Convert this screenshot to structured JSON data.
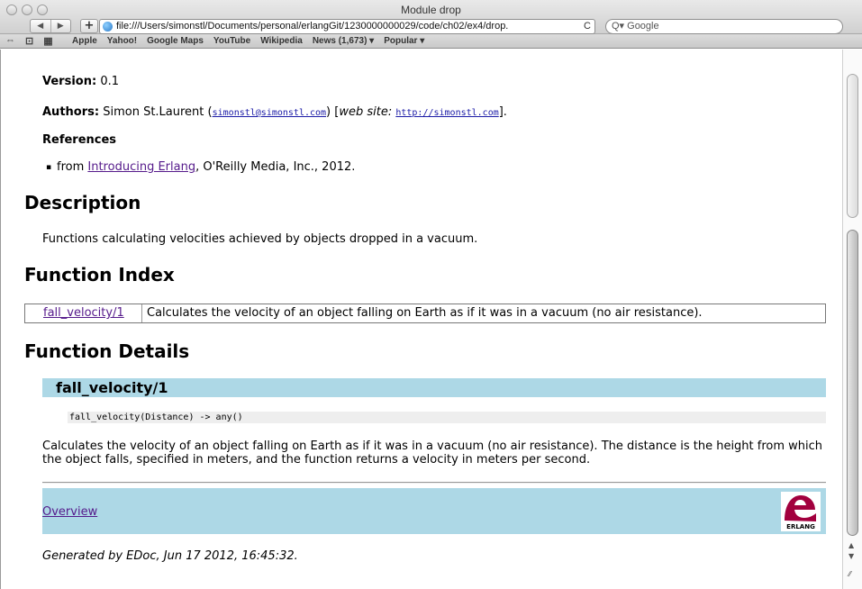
{
  "window": {
    "title": "Module drop"
  },
  "toolbar": {
    "back_label": "◀",
    "forward_label": "▶",
    "add_label": "+",
    "url": "file:///Users/simonstl/Documents/personal/erlangGit/1230000000029/code/ch02/ex4/drop.",
    "reload_label": "C",
    "search_placeholder": "Q▾ Google"
  },
  "bookmarks": {
    "items": [
      "Apple",
      "Yahoo!",
      "Google Maps",
      "YouTube",
      "Wikipedia",
      "News (1,673) ▾",
      "Popular ▾"
    ]
  },
  "page": {
    "version_label": "Version:",
    "version_value": "0.1",
    "authors_label": "Authors:",
    "author_name": "Simon St.Laurent (",
    "author_email": "simonstl@simonstl.com",
    "author_mid": ") [",
    "website_label": "web site:",
    "website_url": "http://simonstl.com",
    "author_end": "].",
    "references_heading": "References",
    "ref_prefix": "from ",
    "ref_link": "Introducing Erlang",
    "ref_suffix": ", O'Reilly Media, Inc., 2012.",
    "description_heading": "Description",
    "description_text": "Functions calculating velocities achieved by objects dropped in a vacuum.",
    "index_heading": "Function Index",
    "index_rows": [
      {
        "name": "fall_velocity/1",
        "summary": "Calculates the velocity of an object falling on Earth as if it was in a vacuum (no air resistance)."
      }
    ],
    "details_heading": "Function Details",
    "function_name": "fall_velocity/1",
    "function_spec": "fall_velocity(Distance) -> any()",
    "function_description": "Calculates the velocity of an object falling on Earth as if it was in a vacuum (no air resistance). The distance is the height from which the object falls, specified in meters, and the function returns a velocity in meters per second.",
    "overview_link": "Overview",
    "logo_text": "ERLANG",
    "generated_text": "Generated by EDoc, Jun 17 2012, 16:45:32."
  },
  "colors": {
    "header_bar": "#add8e6",
    "link": "#551a8b",
    "logo_red": "#a2003e"
  }
}
